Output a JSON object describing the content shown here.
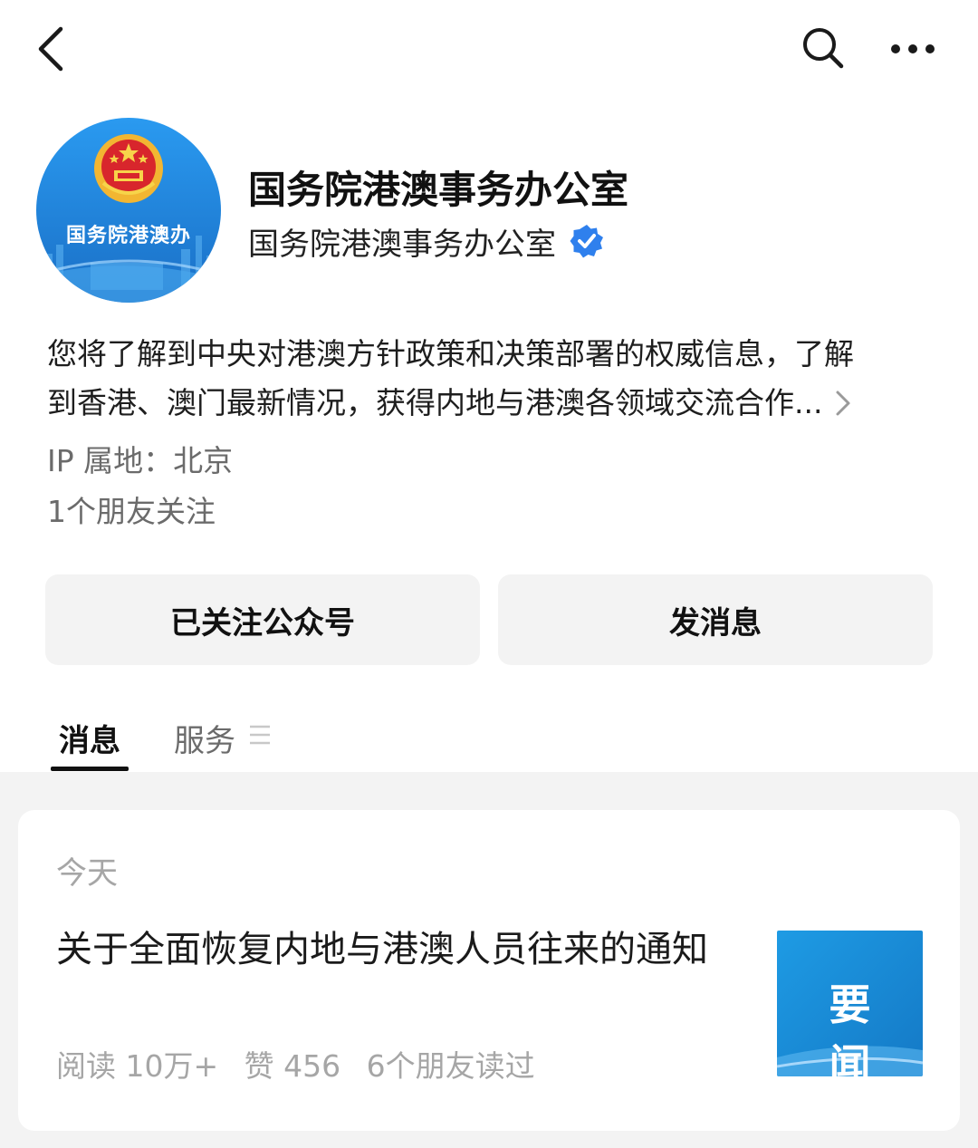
{
  "account": {
    "title": "国务院港澳事务办公室",
    "subname": "国务院港澳事务办公室",
    "avatar_label": "国务院港澳办",
    "description_line1": "您将了解到中央对港澳方针政策和决策部署的权威信息，了解",
    "description_line2": "到香港、澳门最新情况，获得内地与港澳各领域交流合作...",
    "ip_location": "IP 属地：北京",
    "friends_following": "1个朋友关注"
  },
  "actions": {
    "follow_label": "已关注公众号",
    "message_label": "发消息"
  },
  "tabs": {
    "messages": "消息",
    "services": "服务"
  },
  "feed": {
    "date": "今天",
    "article": {
      "title": "关于全面恢复内地与港澳人员往来的通知",
      "reads": "阅读 10万+",
      "likes": "赞 456",
      "friends_read": "6个朋友读过",
      "thumbnail_text": "要闻"
    }
  },
  "colors": {
    "verified_blue": "#2f80ed",
    "avatar_blue": "#1d8be0",
    "thumb_blue": "#1a8fd8",
    "button_bg": "#f3f3f3",
    "feed_bg": "#f3f3f3"
  },
  "icons": [
    "back-arrow-icon",
    "search-icon",
    "more-icon",
    "verified-icon",
    "chevron-right-icon",
    "menu-icon",
    "national-emblem-icon"
  ]
}
